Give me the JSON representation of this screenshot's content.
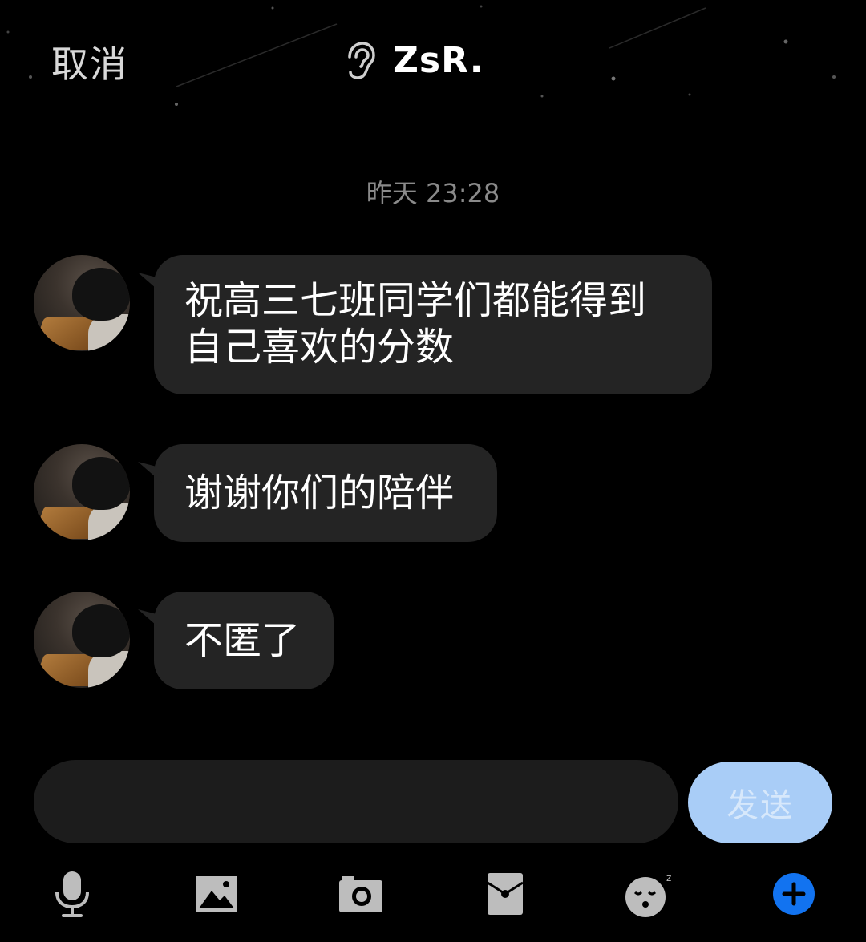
{
  "header": {
    "cancel_label": "取消",
    "title": "ZsR.",
    "ear_icon": "ear-icon"
  },
  "timestamp": "昨天 23:28",
  "messages": [
    {
      "lines": [
        "祝高三七班同学们都能得到",
        "自己喜欢的分数"
      ]
    },
    {
      "lines": [
        "谢谢你们的陪伴"
      ]
    },
    {
      "lines": [
        "不匿了"
      ]
    }
  ],
  "input": {
    "value": "",
    "send_label": "发送"
  },
  "toolbar": {
    "items": [
      "microphone-icon",
      "image-icon",
      "camera-icon",
      "red-packet-icon",
      "sleepy-face-icon",
      "plus-icon"
    ]
  },
  "colors": {
    "background": "#000000",
    "bubble": "#242424",
    "send_button": "#a9cdf7",
    "plus_button": "#1273f0"
  }
}
